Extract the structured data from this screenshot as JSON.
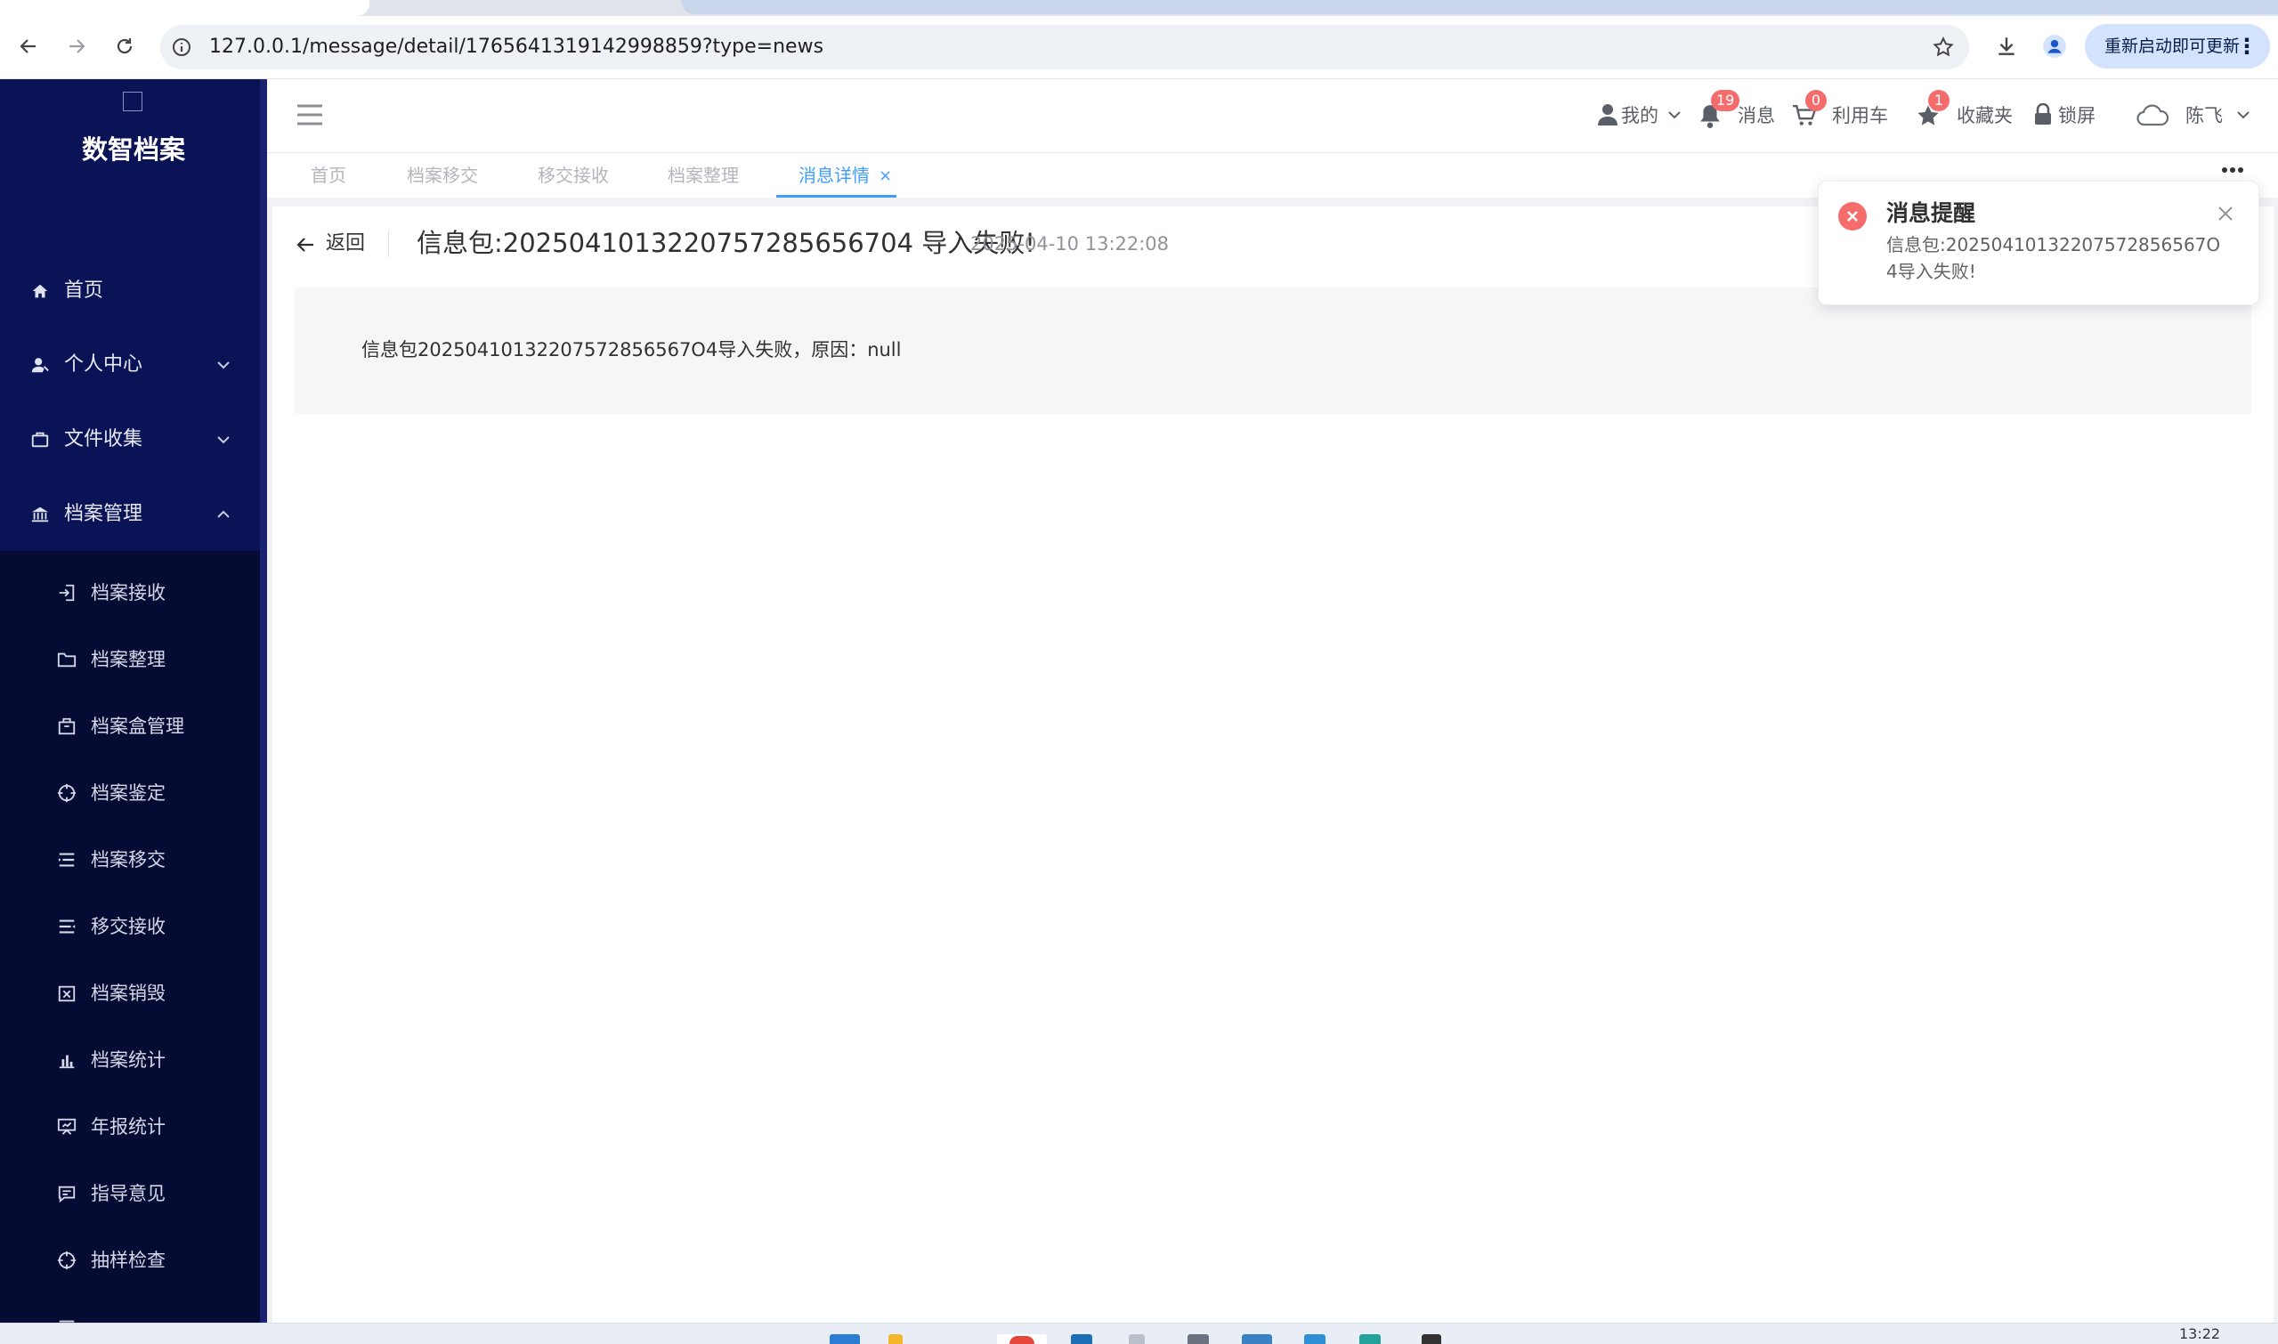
{
  "browser": {
    "url": "127.0.0.1/message/detail/1765641319142998859?type=news",
    "update_label": "重新启动即可更新",
    "update_menu": "⋮"
  },
  "sidebar": {
    "brand": "数智档案",
    "items": [
      {
        "label": "首页",
        "icon": "home-icon"
      },
      {
        "label": "个人中心",
        "icon": "user-icon"
      },
      {
        "label": "文件收集",
        "icon": "briefcase-icon"
      },
      {
        "label": "档案管理",
        "icon": "bank-icon"
      }
    ],
    "subitems": [
      {
        "label": "档案接收",
        "icon": "import-icon"
      },
      {
        "label": "档案整理",
        "icon": "folder-icon"
      },
      {
        "label": "档案盒管理",
        "icon": "box-icon"
      },
      {
        "label": "档案鉴定",
        "icon": "target-icon"
      },
      {
        "label": "档案移交",
        "icon": "list-icon"
      },
      {
        "label": "移交接收",
        "icon": "list-receive-icon"
      },
      {
        "label": "档案销毁",
        "icon": "destroy-icon"
      },
      {
        "label": "档案统计",
        "icon": "bar-chart-icon"
      },
      {
        "label": "年报统计",
        "icon": "board-icon"
      },
      {
        "label": "指导意见",
        "icon": "comment-icon"
      },
      {
        "label": "抽样检查",
        "icon": "target-icon"
      },
      {
        "label": "",
        "icon": "more-icon"
      }
    ]
  },
  "header": {
    "mine": "我的",
    "messages": "消息",
    "messages_count": "19",
    "cart": "利用车",
    "cart_count": "0",
    "favorites": "收藏夹",
    "favorites_count": "1",
    "lock": "锁屏",
    "user": "陈飞"
  },
  "tags": [
    {
      "label": "首页",
      "active": false
    },
    {
      "label": "档案移交",
      "active": false
    },
    {
      "label": "移交接收",
      "active": false
    },
    {
      "label": "档案整理",
      "active": false
    },
    {
      "label": "消息详情",
      "active": true
    }
  ],
  "tag_close": "×",
  "detail": {
    "back": "返回",
    "title": "信息包:2025041013220757285656704 导入失败!",
    "time": "2025-04-10 13:22:08",
    "body": "信息包20250410132207572856567O4导入失败，原因：null"
  },
  "notification": {
    "title": "消息提醒",
    "body": "信息包:20250410132207572856567O4导入失败!"
  },
  "taskbar": {
    "clock": "13:22"
  },
  "colors": {
    "sidebar": "#0b1357",
    "submenu": "#060b33",
    "accent": "#409eff",
    "badge": "#f56c6c"
  }
}
